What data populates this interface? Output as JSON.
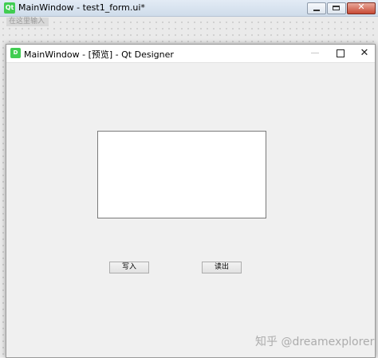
{
  "designer": {
    "title": "MainWindow - test1_form.ui*",
    "app_icon": "Qt",
    "menu_placeholder": "在这里输入"
  },
  "preview": {
    "title": "MainWindow - [预览] - Qt Designer",
    "app_icon": "D",
    "buttons": {
      "write": "写入",
      "read": "读出"
    }
  },
  "watermark": "知乎 @dreamexplorer"
}
